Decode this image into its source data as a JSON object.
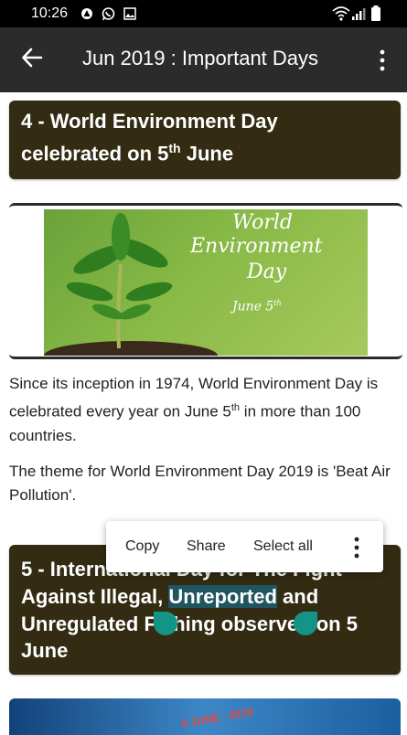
{
  "status": {
    "time": "10:26"
  },
  "toolbar": {
    "title": "Jun 2019 : Important Days"
  },
  "card1": {
    "prefix": "4 - World Environment Day",
    "line2_a": "celebrated on 5",
    "sup": "th",
    "line2_b": " June"
  },
  "image1": {
    "line1": "World",
    "line2": "Environment",
    "line3": "Day",
    "line4": "June 5",
    "sup": "th"
  },
  "para1": {
    "a": "Since its inception in 1974, World Environment Day is celebrated every year on June 5",
    "sup": "th",
    "b": " in more than 100 countries."
  },
  "para2": {
    "text": "The theme for World Environment Day 2019 is 'Beat Air Pollution'."
  },
  "card2": {
    "line1": "5 - International Day for The Fight",
    "line2_a": "Against Illegal, ",
    "line2_hl": "Unreported",
    "line2_b": " and",
    "line3": "Unregulated Fishing observed on 5",
    "line4": "June"
  },
  "popup": {
    "copy": "Copy",
    "share": "Share",
    "select_all": "Select all"
  },
  "banner": {
    "text": "5 JUNE · 2019"
  },
  "colors": {
    "toolbar": "#2b2b2b",
    "card": "#332b12",
    "selection": "#1f5560",
    "handle": "#149486"
  }
}
